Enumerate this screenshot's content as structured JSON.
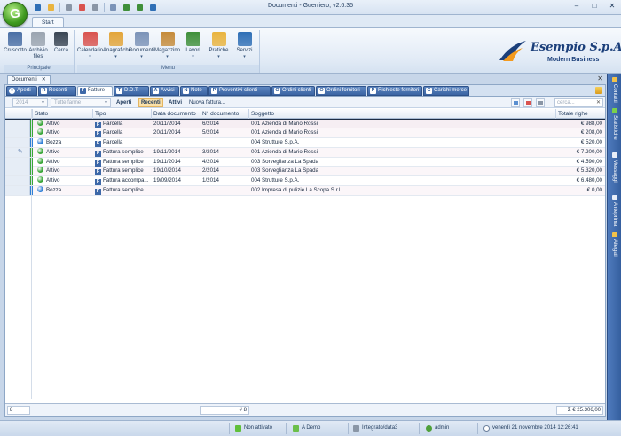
{
  "window": {
    "title": "Documenti - Guerriero, v2.6.35",
    "app_letter": "G",
    "controls": [
      "–",
      "□",
      "✕"
    ]
  },
  "quick_access": [
    "disk-icon",
    "folder-icon",
    "print-icon",
    "mail-icon",
    "settings-icon",
    "document-icon",
    "arrow-icon",
    "chart-icon",
    "help-icon"
  ],
  "ribbon": {
    "tab": "Start",
    "groups": [
      {
        "label": "Principale",
        "buttons": [
          {
            "label": "Cruscotto",
            "icon": "dashboard-icon",
            "color": "#4a6fa5",
            "dropdown": false
          },
          {
            "label": "Archivio\nfiles",
            "icon": "archive-icon",
            "color": "#9aa4b0",
            "dropdown": false
          },
          {
            "label": "Cerca",
            "icon": "binoculars-icon",
            "color": "#3a4654",
            "dropdown": false
          }
        ]
      },
      {
        "label": "Menu",
        "buttons": [
          {
            "label": "Calendario",
            "icon": "calendar-icon",
            "color": "#d9534f",
            "dropdown": true
          },
          {
            "label": "Anagrafiche",
            "icon": "contacts-icon",
            "color": "#e3a53a",
            "dropdown": true
          },
          {
            "label": "Documenti",
            "icon": "documents-icon",
            "color": "#7b93b8",
            "dropdown": true
          },
          {
            "label": "Magazzino",
            "icon": "warehouse-icon",
            "color": "#c58b3a",
            "dropdown": true
          },
          {
            "label": "Lavori",
            "icon": "work-icon",
            "color": "#3f8f3a",
            "dropdown": true
          },
          {
            "label": "Pratiche",
            "icon": "folder-icon",
            "color": "#e9b43f",
            "dropdown": true
          },
          {
            "label": "Servizi",
            "icon": "globe-icon",
            "color": "#2f6fb6",
            "dropdown": true
          }
        ]
      }
    ]
  },
  "brand": {
    "name": "Esempio S.p.A.",
    "tagline": "Modern Business"
  },
  "document_tab": {
    "label": "Documenti",
    "close": "✕"
  },
  "category_tabs": [
    {
      "label": "Aperti",
      "icon": "●",
      "style": "blue"
    },
    {
      "label": "Recenti",
      "icon": "R",
      "style": "blue"
    },
    {
      "label": "Fatture",
      "icon": "F",
      "style": "active"
    },
    {
      "label": "D.D.T.",
      "icon": "T",
      "style": "blue"
    },
    {
      "label": "Avvisi",
      "icon": "A",
      "style": "blue"
    },
    {
      "label": "Note",
      "icon": "N",
      "style": "blue"
    },
    {
      "label": "Preventivi clienti",
      "icon": "P",
      "style": "blue"
    },
    {
      "label": "Ordini clienti",
      "icon": "O",
      "style": "blue"
    },
    {
      "label": "Ordini fornitori",
      "icon": "O",
      "style": "blue"
    },
    {
      "label": "Richieste fornitori",
      "icon": "P",
      "style": "blue"
    },
    {
      "label": "Carichi merce",
      "icon": "C",
      "style": "blue"
    }
  ],
  "filters": {
    "year": "2014",
    "series": "Tutte fanne",
    "buttons": [
      {
        "label": "Aperti",
        "selected": false
      },
      {
        "label": "Recenti",
        "selected": true
      },
      {
        "label": "Attivi",
        "selected": false
      }
    ],
    "new_label": "Nuova fattura...",
    "search_placeholder": "cerca..."
  },
  "columns": [
    "Stato",
    "Tipo",
    "Data documento",
    "N° documento",
    "Soggetto",
    "Totale righe"
  ],
  "rows": [
    {
      "stato": "Attivo",
      "status_color": "#3aa63a",
      "tipo": "Parcella",
      "data": "20/11/2014",
      "numero": "6/2014",
      "soggetto": "001 Azienda di Mario Rossi",
      "totale": "€ 988,00",
      "selected": true,
      "pinned": false
    },
    {
      "stato": "Attivo",
      "status_color": "#3aa63a",
      "tipo": "Parcella",
      "data": "20/11/2014",
      "numero": "5/2014",
      "soggetto": "001 Azienda di Mario Rossi",
      "totale": "€ 208,00",
      "selected": false,
      "pinned": false
    },
    {
      "stato": "Bozza",
      "status_color": "#2f7fd6",
      "tipo": "Parcella",
      "data": "",
      "numero": "",
      "soggetto": "004 Strutture S.p.A.",
      "totale": "€ 520,00",
      "selected": false,
      "pinned": false
    },
    {
      "stato": "Attivo",
      "status_color": "#3aa63a",
      "tipo": "Fattura semplice",
      "data": "19/11/2014",
      "numero": "3/2014",
      "soggetto": "001 Azienda di Mario Rossi",
      "totale": "€ 7.200,00",
      "selected": false,
      "pinned": true
    },
    {
      "stato": "Attivo",
      "status_color": "#3aa63a",
      "tipo": "Fattura semplice",
      "data": "19/11/2014",
      "numero": "4/2014",
      "soggetto": "003 Sorveglianza La Spada",
      "totale": "€ 4.590,00",
      "selected": false,
      "pinned": false
    },
    {
      "stato": "Attivo",
      "status_color": "#3aa63a",
      "tipo": "Fattura semplice",
      "data": "19/10/2014",
      "numero": "2/2014",
      "soggetto": "003 Sorveglianza La Spada",
      "totale": "€ 5.320,00",
      "selected": false,
      "pinned": false
    },
    {
      "stato": "Attivo",
      "status_color": "#3aa63a",
      "tipo": "Fattura accompa...",
      "data": "19/09/2014",
      "numero": "1/2014",
      "soggetto": "004 Strutture S.p.A.",
      "totale": "€ 6.480,00",
      "selected": false,
      "pinned": false
    },
    {
      "stato": "Bozza",
      "status_color": "#2f7fd6",
      "tipo": "Fattura semplice",
      "data": "",
      "numero": "",
      "soggetto": "002 Impresa di pulizie La Scopa S.r.l.",
      "totale": "€ 0,00",
      "selected": false,
      "pinned": false
    }
  ],
  "footer": {
    "count": "8",
    "count_label": "# 8",
    "total": "Σ € 25.306,00"
  },
  "side_tabs": [
    {
      "label": "Contatti",
      "color": "#f2c24a"
    },
    {
      "label": "Statistiche",
      "color": "#7ad04a"
    },
    {
      "label": "Messaggi",
      "color": "#e8eef8"
    },
    {
      "label": "Anteprima",
      "color": "#e8eef8"
    },
    {
      "label": "Allegati",
      "color": "#f2c24a"
    }
  ],
  "statusbar": {
    "activation": "Non attivato",
    "mode": "A Demo",
    "database": "Integrato/data3",
    "user": "admin",
    "datetime": "venerdì 21 novembre 2014 12:26:41"
  }
}
